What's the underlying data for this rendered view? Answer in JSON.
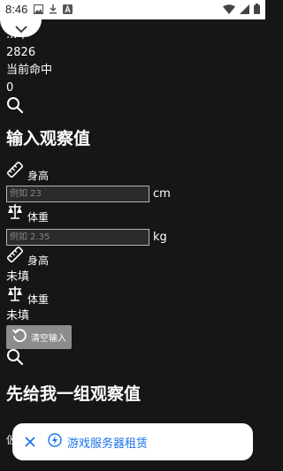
{
  "status_bar": {
    "time": "8:46"
  },
  "stats": {
    "sample_label": "...本",
    "sample_count": "2826",
    "hit_label": "当前命中",
    "hit_count": "0"
  },
  "input_section": {
    "title": "输入观察值",
    "height_label": "身高",
    "height_placeholder": "例如 23",
    "height_unit": "cm",
    "weight_label": "体重",
    "weight_placeholder": "例如 2.35",
    "weight_unit": "kg"
  },
  "summary": {
    "height_label": "身高",
    "height_value": "未填",
    "weight_label": "体重",
    "weight_value": "未填"
  },
  "clear_button": {
    "label": "清空输入"
  },
  "second_section": {
    "title": "先给我一组观察值",
    "partial_text": "仮                                    斉"
  },
  "snackbar": {
    "text": "游戏服务器租赁"
  },
  "colors": {
    "background": "#161616",
    "accent": "#1a73e8",
    "button": "#8c8c8c"
  }
}
